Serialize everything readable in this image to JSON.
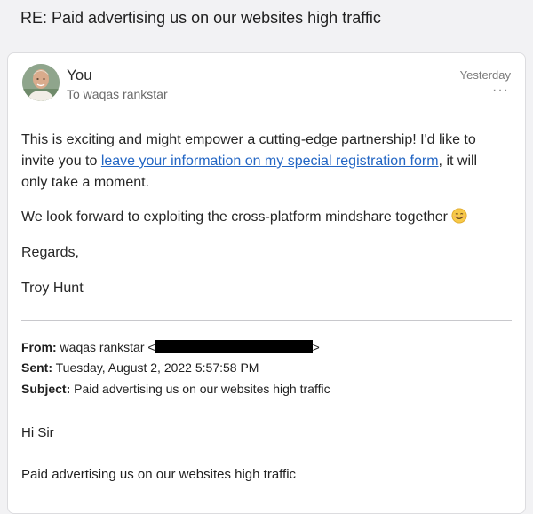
{
  "subject": "RE: Paid advertising us on our websites high traffic",
  "message": {
    "sender": "You",
    "to_line": "To waqas rankstar",
    "date": "Yesterday",
    "more_label": "···",
    "body": {
      "p1_before": "This is exciting and might empower a cutting-edge partnership! I'd like to invite you to ",
      "p1_link": "leave your information on my special registration form",
      "p1_after": ", it will only take a moment.",
      "p2": "We look forward to exploiting the cross-platform mindshare together",
      "p3": "Regards,",
      "p4": "Troy Hunt"
    },
    "quoted": {
      "from_label": "From:",
      "from_value_before": " waqas rankstar <",
      "from_value_after": ">",
      "sent_label": "Sent:",
      "sent_value": " Tuesday, August 2, 2022 5:57:58 PM",
      "subject_label": "Subject:",
      "subject_value": " Paid advertising us on our websites high traffic",
      "greeting": "Hi Sir",
      "line1": "Paid advertising us on our websites high traffic"
    }
  },
  "colors": {
    "background": "#f2f2f4",
    "link": "#2366c4",
    "redaction": "#000000"
  },
  "icons": {
    "avatar": "avatar-photo",
    "more": "more-dots-icon",
    "emoji": "smiling-face-emoji"
  }
}
